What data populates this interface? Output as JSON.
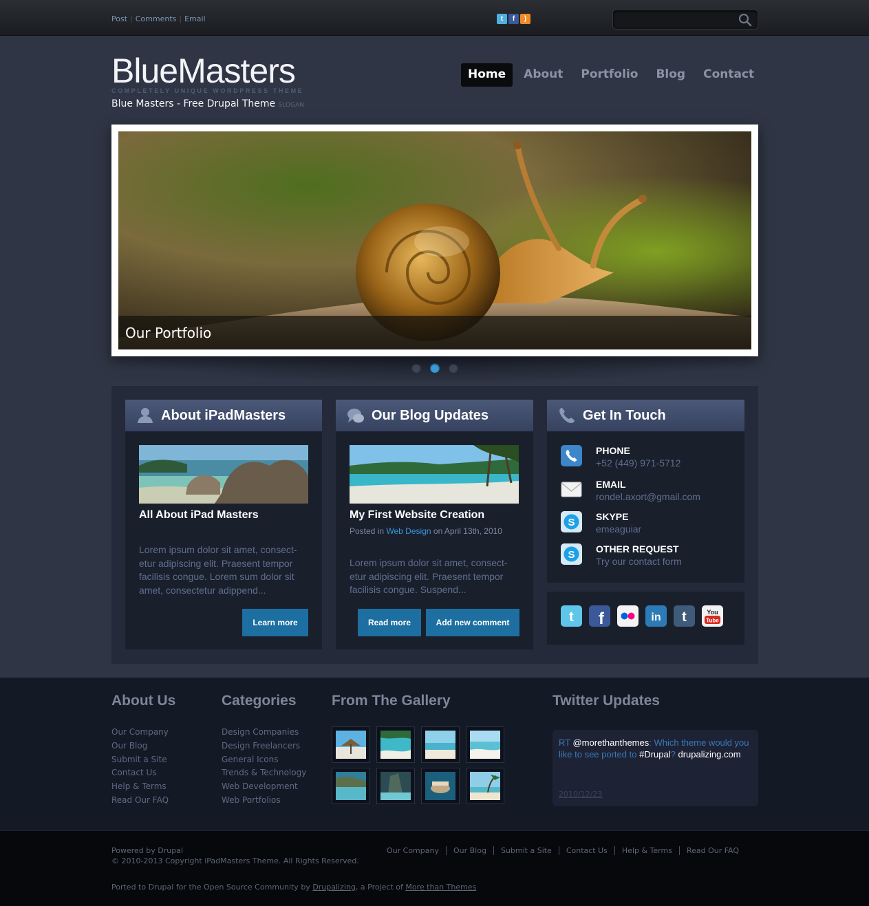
{
  "topbar": {
    "links": [
      "Post",
      "Comments",
      "Email"
    ],
    "search_placeholder": ""
  },
  "header": {
    "logo": "BlueMasters",
    "logo_tagline": "COMPLETELY UNIQUE WORDPRESS THEME",
    "site_name": "Blue Masters - Free Drupal Theme",
    "slogan": "SLOGAN"
  },
  "nav": {
    "items": [
      "Home",
      "About",
      "Portfolio",
      "Blog",
      "Contact"
    ],
    "active": "Home"
  },
  "slider": {
    "caption": "Our Portfolio",
    "slide_count": 3,
    "active_slide": 2
  },
  "about_box": {
    "heading": "About iPadMasters",
    "post_title": "All About iPad Masters",
    "excerpt": "Lorem ipsum dolor sit amet, consect-etur adipiscing elit. Praesent tempor facilisis congue. Lorem sum dolor sit amet, consectetur adippend...",
    "button": "Learn more"
  },
  "blog_box": {
    "heading": "Our Blog Updates",
    "post_title": "My First Website Creation",
    "meta_prefix": "Posted in",
    "meta_category": "Web Design",
    "meta_suffix": "on April 13th, 2010",
    "excerpt": "Lorem ipsum dolor sit amet, consect-etur adipiscing elit. Praesent tempor facilisis congue. Suspend...",
    "read_more": "Read more",
    "add_comment": "Add new comment"
  },
  "contact_box": {
    "heading": "Get In Touch",
    "items": [
      {
        "label": "PHONE",
        "value": "+52 (449) 971-5712",
        "icon": "phone-icon"
      },
      {
        "label": "EMAIL",
        "value": "rondel.axort@gmail.com",
        "icon": "email-icon"
      },
      {
        "label": "SKYPE",
        "value": "emeaguiar",
        "icon": "skype-icon"
      },
      {
        "label": "OTHER REQUEST",
        "value": "Try our contact form",
        "icon": "skype-icon"
      }
    ],
    "social": [
      "twitter",
      "facebook",
      "flickr",
      "linkedin",
      "tumblr",
      "youtube"
    ]
  },
  "footer": {
    "about_heading": "About Us",
    "about_links": [
      "Our Company",
      "Our Blog",
      "Submit a Site",
      "Contact Us",
      "Help & Terms",
      "Read Our FAQ"
    ],
    "categories_heading": "Categories",
    "categories_links": [
      "Design Companies",
      "Design Freelancers",
      "General Icons",
      "Trends & Technology",
      "Web Development",
      "Web Portfolios"
    ],
    "gallery_heading": "From The Gallery",
    "twitter_heading": "Twitter Updates",
    "tweet": {
      "rt": "RT",
      "handle": "@morethanthemes",
      "text1": ": Which theme would you like to see ported to",
      "hashtag": "#Drupal",
      "text2": "?",
      "link": "drupalizing.com",
      "date": "2010/12/23"
    }
  },
  "bottom": {
    "powered": "Powered by Drupal",
    "copyright": "© 2010-2013 Copyright iPadMasters Theme. All Rights Reserved.",
    "ported_prefix": "Ported to Drupal for the Open Source Community by",
    "ported_link1": "Drupalizing",
    "ported_mid": ", a Project of",
    "ported_link2": "More than Themes",
    "links": [
      "Our Company",
      "Our Blog",
      "Submit a Site",
      "Contact Us",
      "Help & Terms",
      "Read Our FAQ"
    ]
  },
  "colors": {
    "background": "#2f3544",
    "accent_blue": "#1c6fa0",
    "box_head": "#4b5877",
    "link_blue": "#3a95d6"
  }
}
